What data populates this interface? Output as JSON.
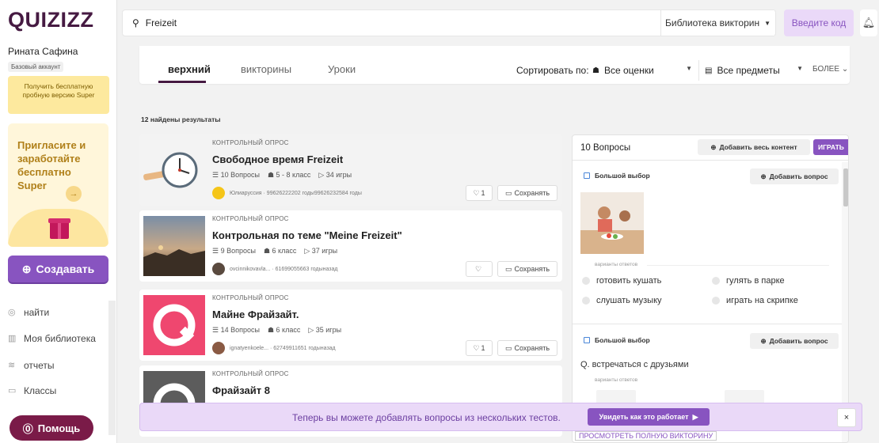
{
  "brand": {
    "logo_text": "QUIZIZZ",
    "accent": "#8854c0",
    "logo_color": "#461a42"
  },
  "user": {
    "name": "Рината Сафина",
    "account_type": "Базовый аккаунт"
  },
  "sidebar": {
    "trial_text": "Получить бесплатную пробную версию Super",
    "invite_text": "Пригласите и заработайте бесплатно Super",
    "invite_arrow": "→",
    "create_label": "Создавать",
    "nav": [
      {
        "label": "найти",
        "icon": "compass-icon"
      },
      {
        "label": "Моя библиотека",
        "icon": "library-icon"
      },
      {
        "label": "отчеты",
        "icon": "reports-icon"
      },
      {
        "label": "Классы",
        "icon": "classes-icon"
      }
    ],
    "help_label": "Помощь"
  },
  "topbar": {
    "search_value": "Freizeit",
    "library_select": "Библиотека викторин",
    "code_button": "Введите код"
  },
  "filters": {
    "tabs": [
      "верхний",
      "викторины",
      "Уроки"
    ],
    "active_tab": 0,
    "sort_label": "Сортировать по:",
    "grade_select": "Все оценки",
    "subject_select": "Все предметы",
    "more_label": "БОЛЕЕ"
  },
  "results": {
    "count_text": "12 найдены результаты",
    "items": [
      {
        "kind": "КОНТРОЛЬНЫЙ ОПРОС",
        "title": "Свободное время Freizeit",
        "questions": "10 Вопросы",
        "grade": "5 - 8 класс",
        "plays": "34 игры",
        "author": "Юлиарусcия · 99626222202 годы99626232584 годы",
        "likes": "1",
        "save_label": "Сохранять"
      },
      {
        "kind": "КОНТРОЛЬНЫЙ ОПРОС",
        "title": "Контрольная по теме \"Meine Freizeit\"",
        "questions": "9 Вопросы",
        "grade": "6 класс",
        "plays": "37 игры",
        "author": "ovcinnikovavla... · 61699055663 годыназад",
        "likes": "",
        "save_label": "Сохранять"
      },
      {
        "kind": "КОНТРОЛЬНЫЙ ОПРОС",
        "title": "Майне Фрайзайт.",
        "questions": "14 Вопросы",
        "grade": "6 класс",
        "plays": "35 игры",
        "author": "ignatyenkoele... · 62749911651 годыназад",
        "likes": "1",
        "save_label": "Сохранять"
      },
      {
        "kind": "КОНТРОЛЬНЫЙ ОПРОС",
        "title": "Фрайзайт 8",
        "questions": "",
        "grade": "",
        "plays": "",
        "author": "",
        "likes": "",
        "save_label": ""
      }
    ]
  },
  "preview": {
    "count": "10 Вопросы",
    "add_all": "Добавить весь контент",
    "play": "ИГРАТЬ",
    "questions": [
      {
        "type": "Большой выбор",
        "add_label": "Добавить вопрос",
        "options_label": "варианты ответов",
        "options": [
          "готовить кушать",
          "гулять в парке",
          "слушать музыку",
          "играть на скрипке"
        ]
      },
      {
        "type": "Большой выбор",
        "add_label": "Добавить вопрос",
        "text": "Q. встречаться с друзьями",
        "options_label": "варианты ответов"
      }
    ]
  },
  "banner": {
    "text": "Теперь вы можете добавлять вопросы из нескольких тестов.",
    "button": "Увидеть как это работает",
    "close": "×",
    "under": "ПРОСМОТРЕТЬ ПОЛНУЮ ВИКТОРИНУ"
  }
}
